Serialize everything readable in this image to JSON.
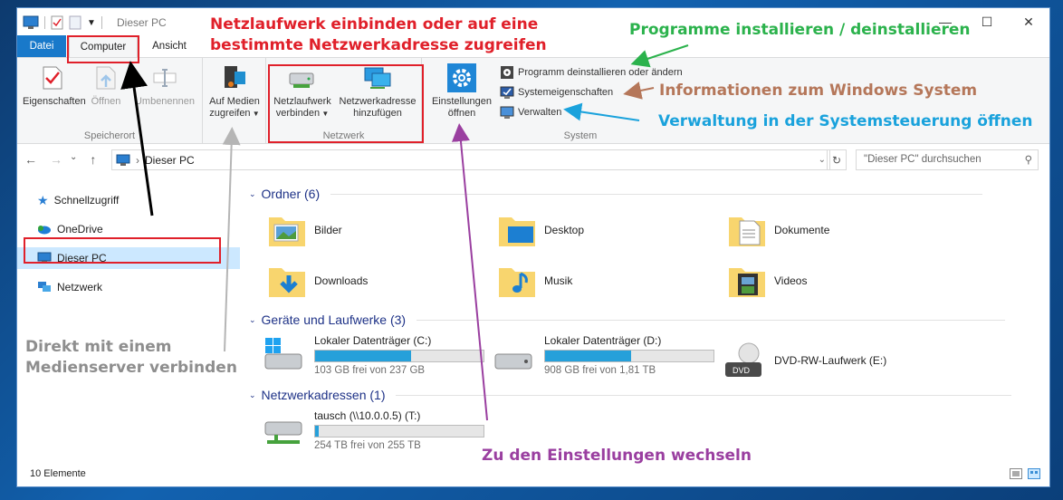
{
  "window": {
    "title": "Dieser PC"
  },
  "tabs": [
    {
      "label": "Datei"
    },
    {
      "label": "Computer"
    },
    {
      "label": "Ansicht"
    }
  ],
  "ribbon": {
    "speicherort": {
      "label": "Speicherort",
      "buttons": [
        {
          "label": "Eigenschaften"
        },
        {
          "label": "Öffnen"
        },
        {
          "label": "Umbenennen"
        }
      ]
    },
    "media": {
      "line1": "Auf Medien",
      "line2": "zugreifen"
    },
    "netzwerk": {
      "label": "Netzwerk",
      "map_line1": "Netzlaufwerk",
      "map_line2": "verbinden",
      "add_line1": "Netzwerkadresse",
      "add_line2": "hinzufügen"
    },
    "system": {
      "label": "System",
      "settings_line1": "Einstellungen",
      "settings_line2": "öffnen",
      "uninstall": "Programm deinstallieren oder ändern",
      "properties": "Systemeigenschaften",
      "manage": "Verwalten"
    }
  },
  "address": {
    "path": "Dieser PC",
    "search_placeholder": "\"Dieser PC\" durchsuchen"
  },
  "nav": [
    {
      "label": "Schnellzugriff"
    },
    {
      "label": "OneDrive"
    },
    {
      "label": "Dieser PC"
    },
    {
      "label": "Netzwerk"
    }
  ],
  "sections": {
    "folders": "Ordner (6)",
    "drives": "Geräte und Laufwerke (3)",
    "network": "Netzwerkadressen (1)"
  },
  "folders": [
    {
      "name": "Bilder"
    },
    {
      "name": "Desktop"
    },
    {
      "name": "Dokumente"
    },
    {
      "name": "Downloads"
    },
    {
      "name": "Musik"
    },
    {
      "name": "Videos"
    }
  ],
  "drives": [
    {
      "name": "Lokaler Datenträger (C:)",
      "free": "103 GB frei von 237 GB",
      "used_fraction": 0.57
    },
    {
      "name": "Lokaler Datenträger (D:)",
      "free": "908 GB frei von 1,81 TB",
      "used_fraction": 0.51
    },
    {
      "name": "DVD-RW-Laufwerk (E:)"
    }
  ],
  "network_locations": [
    {
      "name": "tausch (\\\\10.0.0.5) (T:)",
      "free": "254 TB frei von 255 TB",
      "used_fraction": 0.01
    }
  ],
  "status": {
    "count": "10 Elemente"
  },
  "annotations": {
    "red": "Netzlaufwerk einbinden oder auf eine",
    "red2": "bestimmte Netzwerkadresse zugreifen",
    "green": "Programme installieren / deinstallieren",
    "brown": "Informationen zum Windows System",
    "blue": "Verwaltung in der Systemsteuerung öffnen",
    "gray1": "Direkt mit einem",
    "gray2": "Medienserver verbinden",
    "purple": "Zu den Einstellungen wechseln"
  }
}
